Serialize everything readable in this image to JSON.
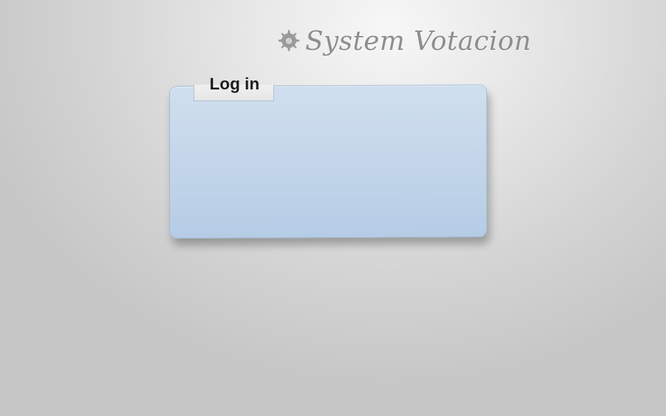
{
  "header": {
    "title": "System Votacion",
    "icon": "gear-icon"
  },
  "login_panel": {
    "tab_label": "Log in"
  },
  "colors": {
    "panel_top": "#d0dfee",
    "panel_bottom": "#b6cce5",
    "title_color": "#8e8e8e"
  }
}
